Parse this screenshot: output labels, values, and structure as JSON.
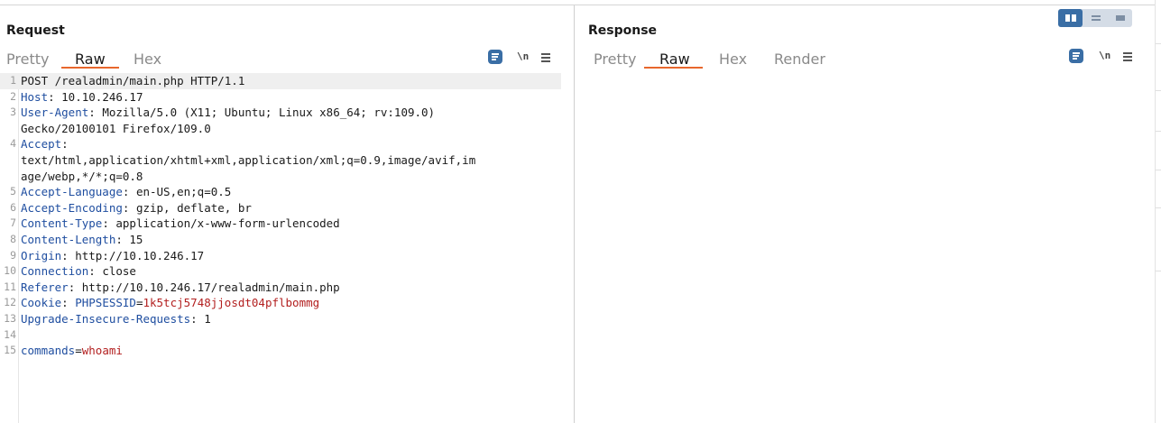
{
  "request": {
    "title": "Request",
    "tabs": [
      {
        "label": "Pretty",
        "active": false
      },
      {
        "label": "Raw",
        "active": true
      },
      {
        "label": "Hex",
        "active": false
      }
    ],
    "toolbar": {
      "wrap_icon": "wrap-lines-icon",
      "newline_label": "\\n",
      "menu_icon": "menu-icon"
    },
    "lines": [
      {
        "n": "1",
        "parts": [
          {
            "t": "POST /realadmin/main.php HTTP/1.1",
            "c": "plain"
          }
        ]
      },
      {
        "n": "2",
        "parts": [
          {
            "t": "Host",
            "c": "key"
          },
          {
            "t": ": 10.10.246.17",
            "c": "plain"
          }
        ]
      },
      {
        "n": "3",
        "parts": [
          {
            "t": "User-Agent",
            "c": "key"
          },
          {
            "t": ": Mozilla/5.0 (X11; Ubuntu; Linux x86_64; rv:109.0)",
            "c": "plain"
          }
        ]
      },
      {
        "n": "",
        "parts": [
          {
            "t": "Gecko/20100101 Firefox/109.0",
            "c": "plain"
          }
        ]
      },
      {
        "n": "4",
        "parts": [
          {
            "t": "Accept",
            "c": "key"
          },
          {
            "t": ":",
            "c": "plain"
          }
        ]
      },
      {
        "n": "",
        "parts": [
          {
            "t": "text/html,application/xhtml+xml,application/xml;q=0.9,image/avif,im",
            "c": "plain"
          }
        ]
      },
      {
        "n": "",
        "parts": [
          {
            "t": "age/webp,*/*;q=0.8",
            "c": "plain"
          }
        ]
      },
      {
        "n": "5",
        "parts": [
          {
            "t": "Accept-Language",
            "c": "key"
          },
          {
            "t": ": en-US,en;q=0.5",
            "c": "plain"
          }
        ]
      },
      {
        "n": "6",
        "parts": [
          {
            "t": "Accept-Encoding",
            "c": "key"
          },
          {
            "t": ": gzip, deflate, br",
            "c": "plain"
          }
        ]
      },
      {
        "n": "7",
        "parts": [
          {
            "t": "Content-Type",
            "c": "key"
          },
          {
            "t": ": application/x-www-form-urlencoded",
            "c": "plain"
          }
        ]
      },
      {
        "n": "8",
        "parts": [
          {
            "t": "Content-Length",
            "c": "key"
          },
          {
            "t": ": 15",
            "c": "plain"
          }
        ]
      },
      {
        "n": "9",
        "parts": [
          {
            "t": "Origin",
            "c": "key"
          },
          {
            "t": ": http://10.10.246.17",
            "c": "plain"
          }
        ]
      },
      {
        "n": "10",
        "parts": [
          {
            "t": "Connection",
            "c": "key"
          },
          {
            "t": ": close",
            "c": "plain"
          }
        ]
      },
      {
        "n": "11",
        "parts": [
          {
            "t": "Referer",
            "c": "key"
          },
          {
            "t": ": http://10.10.246.17/realadmin/main.php",
            "c": "plain"
          }
        ]
      },
      {
        "n": "12",
        "parts": [
          {
            "t": "Cookie",
            "c": "key"
          },
          {
            "t": ": ",
            "c": "plain"
          },
          {
            "t": "PHPSESSID",
            "c": "pkey"
          },
          {
            "t": "=",
            "c": "plain"
          },
          {
            "t": "1k5tcj5748jjosdt04pflbommg",
            "c": "pval"
          }
        ]
      },
      {
        "n": "13",
        "parts": [
          {
            "t": "Upgrade-Insecure-Requests",
            "c": "key"
          },
          {
            "t": ": 1",
            "c": "plain"
          }
        ]
      },
      {
        "n": "14",
        "parts": []
      },
      {
        "n": "15",
        "parts": [
          {
            "t": "commands",
            "c": "pkey"
          },
          {
            "t": "=",
            "c": "plain"
          },
          {
            "t": "whoami",
            "c": "pval"
          }
        ]
      }
    ]
  },
  "response": {
    "title": "Response",
    "tabs": [
      {
        "label": "Pretty",
        "active": false
      },
      {
        "label": "Raw",
        "active": true
      },
      {
        "label": "Hex",
        "active": false
      },
      {
        "label": "Render",
        "active": false
      }
    ],
    "toolbar": {
      "wrap_icon": "wrap-lines-icon",
      "newline_label": "\\n",
      "menu_icon": "menu-icon"
    }
  },
  "layout_switch": {
    "options": [
      "side-by-side-icon",
      "stacked-icon",
      "single-panel-icon"
    ],
    "active": 0
  },
  "colors": {
    "accent": "#e8672c",
    "header_key": "#1f4ea0",
    "param_value": "#b32020",
    "toggle_active": "#3a6ea5"
  }
}
